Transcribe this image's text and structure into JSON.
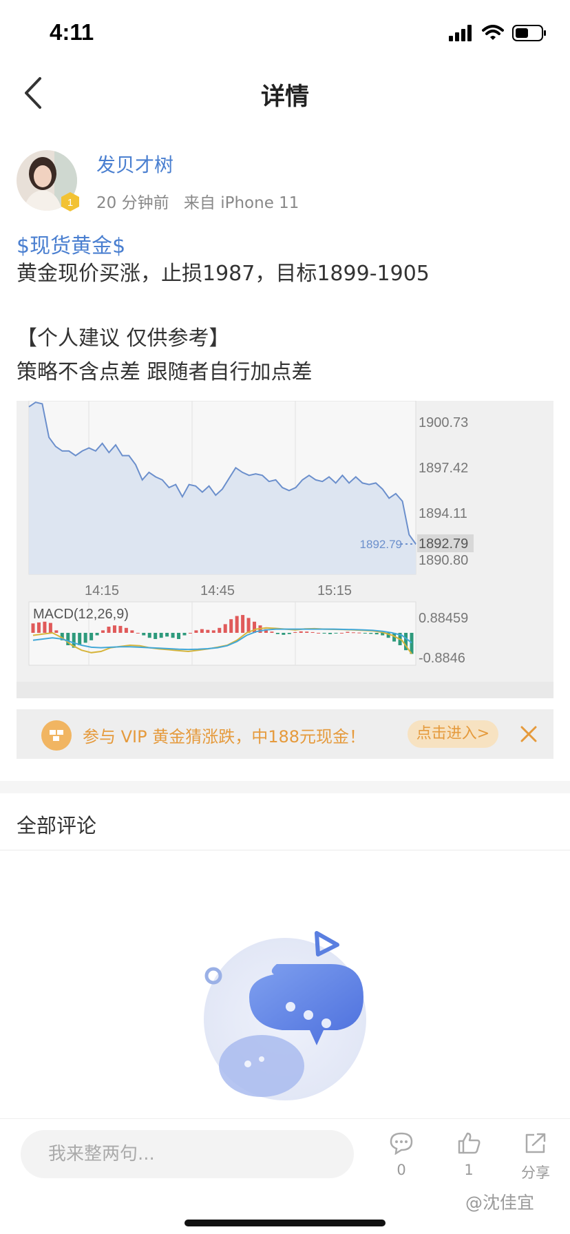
{
  "status_bar": {
    "time": "4:11"
  },
  "nav": {
    "title": "详情"
  },
  "author": {
    "name": "发贝才树",
    "level": "1",
    "time_ago": "20 分钟前",
    "source": "来自 iPhone 11"
  },
  "post": {
    "tag": "$现货黄金$",
    "lines": [
      "黄金现价买涨，止损1987，目标1899-1905",
      "【个人建议 仅供参考】",
      "策略不含点差 跟随者自行加点差"
    ]
  },
  "chart_data": {
    "type": "line",
    "price": {
      "x": [
        "14:00",
        "14:02",
        "14:04",
        "14:06",
        "14:08",
        "14:10",
        "14:12",
        "14:14",
        "14:16",
        "14:18",
        "14:20",
        "14:22",
        "14:24",
        "14:26",
        "14:28",
        "14:30",
        "14:32",
        "14:34",
        "14:36",
        "14:38",
        "14:40",
        "14:42",
        "14:44",
        "14:46",
        "14:48",
        "14:50",
        "14:52",
        "14:54",
        "14:56",
        "14:58",
        "15:00",
        "15:02",
        "15:04",
        "15:06",
        "15:08",
        "15:10",
        "15:12",
        "15:14",
        "15:16",
        "15:18",
        "15:20",
        "15:22",
        "15:24",
        "15:26",
        "15:28",
        "15:30",
        "15:32",
        "15:34",
        "15:36",
        "15:38",
        "15:40",
        "15:42",
        "15:44",
        "15:46",
        "15:48",
        "15:50",
        "15:52",
        "15:54",
        "15:56"
      ],
      "values": [
        1901.8,
        1902.1,
        1902.0,
        1899.8,
        1899.2,
        1898.9,
        1898.9,
        1898.6,
        1898.9,
        1899.1,
        1898.9,
        1899.4,
        1898.8,
        1899.3,
        1898.6,
        1898.6,
        1898.0,
        1897.0,
        1897.5,
        1897.2,
        1897.0,
        1896.5,
        1896.7,
        1895.9,
        1896.7,
        1896.6,
        1896.2,
        1896.6,
        1896.0,
        1896.4,
        1897.1,
        1897.8,
        1897.5,
        1897.3,
        1897.4,
        1897.3,
        1896.9,
        1897.0,
        1896.5,
        1896.3,
        1896.5,
        1897.0,
        1897.3,
        1897.0,
        1896.9,
        1897.2,
        1896.8,
        1897.3,
        1896.8,
        1897.2,
        1896.8,
        1896.7,
        1896.8,
        1896.4,
        1895.8,
        1896.1,
        1895.6,
        1893.4,
        1892.79
      ],
      "last_value": "1892.79",
      "y_ticks": [
        "1900.73",
        "1897.42",
        "1894.11",
        "1890.80"
      ],
      "ylim": [
        1890.8,
        1902.2
      ],
      "x_ticks": [
        "14:15",
        "14:45",
        "15:15"
      ]
    },
    "macd": {
      "label": "MACD(12,26,9)",
      "y_ticks": [
        "0.88459",
        "-0.8846"
      ],
      "ylim": [
        -0.8846,
        0.88459
      ],
      "histogram": [
        0.38,
        0.42,
        0.45,
        0.4,
        0.1,
        -0.3,
        -0.5,
        -0.6,
        -0.5,
        -0.4,
        -0.3,
        -0.1,
        0.1,
        0.25,
        0.3,
        0.28,
        0.2,
        0.1,
        0.0,
        -0.1,
        -0.2,
        -0.25,
        -0.2,
        -0.15,
        -0.2,
        -0.25,
        -0.1,
        0.0,
        0.1,
        0.15,
        0.12,
        0.1,
        0.2,
        0.35,
        0.55,
        0.68,
        0.72,
        0.6,
        0.45,
        0.3,
        0.15,
        0.05,
        -0.05,
        -0.08,
        -0.05,
        0.03,
        0.06,
        0.05,
        0.03,
        0.0,
        -0.03,
        -0.05,
        -0.02,
        0.0,
        0.04,
        0.02,
        0.01,
        -0.02,
        -0.04,
        -0.06,
        -0.1,
        -0.2,
        -0.35,
        -0.5,
        -0.7,
        -0.85
      ],
      "dif": [
        -0.1,
        -0.05,
        0.0,
        -0.2,
        -0.5,
        -0.7,
        -0.8,
        -0.75,
        -0.6,
        -0.55,
        -0.5,
        -0.52,
        -0.6,
        -0.65,
        -0.68,
        -0.72,
        -0.75,
        -0.7,
        -0.65,
        -0.58,
        -0.5,
        -0.3,
        0.0,
        0.15,
        0.2,
        0.18,
        0.15,
        0.12,
        0.16,
        0.17,
        0.15,
        0.14,
        0.13,
        0.12,
        0.1,
        0.08,
        0.02,
        -0.1,
        -0.3,
        -0.85
      ],
      "dea": [
        -0.3,
        -0.25,
        -0.2,
        -0.25,
        -0.38,
        -0.5,
        -0.58,
        -0.6,
        -0.58,
        -0.56,
        -0.56,
        -0.58,
        -0.6,
        -0.62,
        -0.64,
        -0.66,
        -0.67,
        -0.66,
        -0.64,
        -0.6,
        -0.52,
        -0.35,
        -0.1,
        0.05,
        0.12,
        0.15,
        0.15,
        0.15,
        0.15,
        0.15,
        0.15,
        0.15,
        0.14,
        0.13,
        0.12,
        0.1,
        0.06,
        0.0,
        -0.1,
        -0.4
      ]
    }
  },
  "promo": {
    "text": "参与 VIP 黄金猜涨跌，中188元现金！",
    "button": "点击进入>"
  },
  "comments": {
    "title": "全部评论"
  },
  "bottom_bar": {
    "input_placeholder": "我来整两句...",
    "comment_count": "0",
    "like_count": "1",
    "share_label": "分享",
    "watermark": "@沈佳宜"
  },
  "colors": {
    "accent": "#4a7fd0",
    "chart_line": "#6b8fcc",
    "chart_fill": "#dde5f1",
    "macd_up": "#e05a5a",
    "macd_down": "#2e9a7c",
    "dif": "#d6b43a",
    "dea": "#42a8d8",
    "promo": "#e59a3c"
  }
}
